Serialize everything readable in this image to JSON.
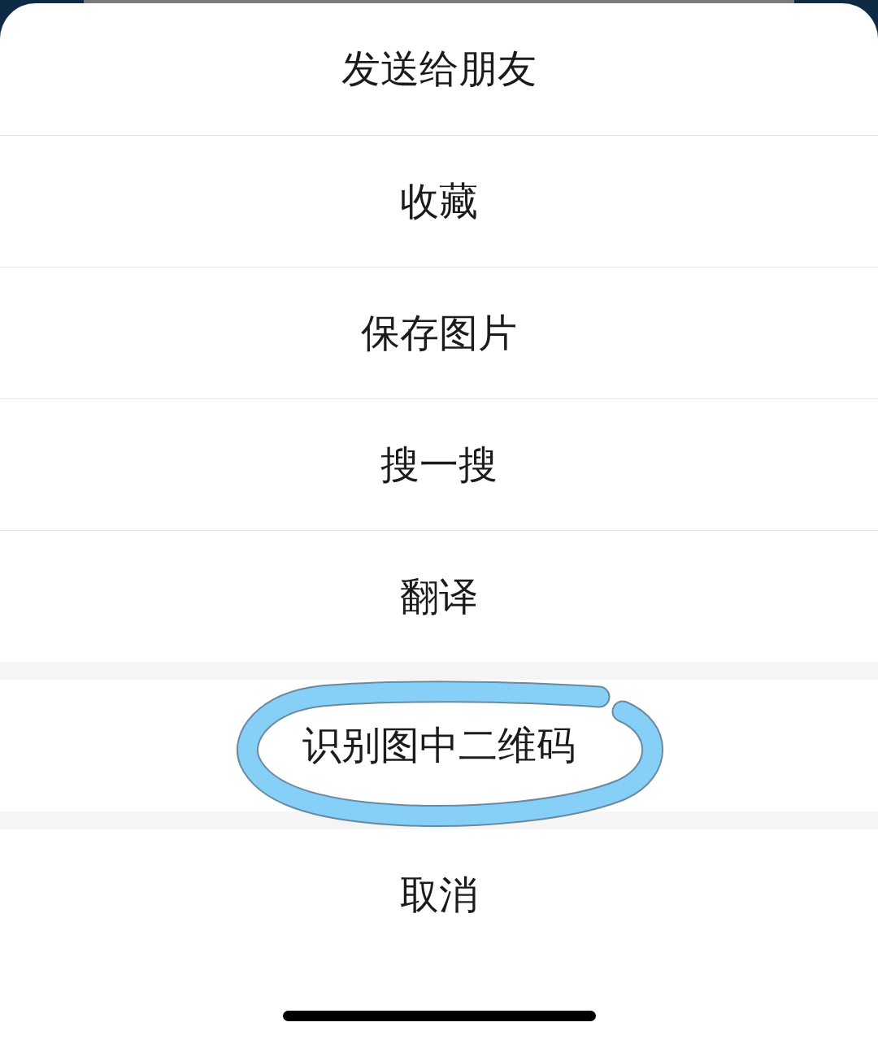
{
  "sheet": {
    "groups": [
      {
        "items": [
          {
            "label": "发送给朋友",
            "circled": false
          },
          {
            "label": "收藏",
            "circled": false
          },
          {
            "label": "保存图片",
            "circled": false
          },
          {
            "label": "搜一搜",
            "circled": false
          },
          {
            "label": "翻译",
            "circled": false
          }
        ]
      },
      {
        "items": [
          {
            "label": "识别图中二维码",
            "circled": true
          }
        ]
      },
      {
        "items": [
          {
            "label": "取消",
            "circled": false
          }
        ]
      }
    ]
  }
}
